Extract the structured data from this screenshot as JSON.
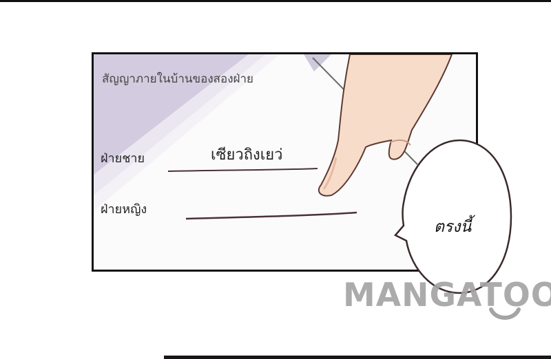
{
  "contract": {
    "title": "สัญญาภายในบ้านของสองฝ่าย",
    "groom_label": "ฝ่ายชาย",
    "groom_name": "เซียวถิงเยว่",
    "bride_label": "ฝ่ายหญิง",
    "bride_name": ""
  },
  "speech_bubble": {
    "text": "ตรงนี้"
  },
  "watermark": {
    "text": "MANGATOON"
  },
  "colors": {
    "panel_border": "#111111",
    "shadow_stripe": "#c9c3d8",
    "skin": "#f7dcc9",
    "skin_outline": "#5c3a32",
    "line_color": "#4a3038",
    "watermark": "#a4a4a4"
  }
}
